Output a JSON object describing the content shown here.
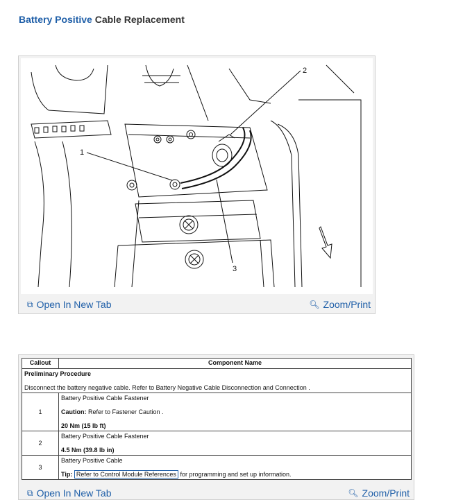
{
  "title": {
    "keyword": "Battery Positive",
    "rest": " Cable Replacement"
  },
  "figure": {
    "callouts": [
      "1",
      "2",
      "3"
    ],
    "open_tab_label": "Open In New Tab",
    "zoom_label": "Zoom/Print",
    "open_icon": "open-new-tab-icon",
    "zoom_icon": "magnifier-icon"
  },
  "table": {
    "headers": [
      "Callout",
      "Component Name"
    ],
    "preliminary_heading": "Preliminary Procedure",
    "preliminary_text": "Disconnect the battery negative cable. Refer to Battery Negative Cable Disconnection and Connection .",
    "rows": [
      {
        "callout": "1",
        "name": "Battery Positive Cable Fastener",
        "caution_label": "Caution:",
        "caution_text": " Refer to Fastener Caution .",
        "torque": "20 Nm (15 lb ft)"
      },
      {
        "callout": "2",
        "name": "Battery Positive Cable Fastener",
        "torque": "4.5 Nm (39.8 lb in)"
      },
      {
        "callout": "3",
        "name": "Battery Positive Cable",
        "tip_label": "Tip:",
        "tip_link": "Refer to Control Module References",
        "tip_rest": " for programming and set up information."
      }
    ],
    "open_tab_label": "Open In New Tab",
    "zoom_label": "Zoom/Print"
  },
  "colors": {
    "link": "#1f5fa8",
    "card_bg": "#f2f2f2",
    "border": "#cfcfcf"
  }
}
